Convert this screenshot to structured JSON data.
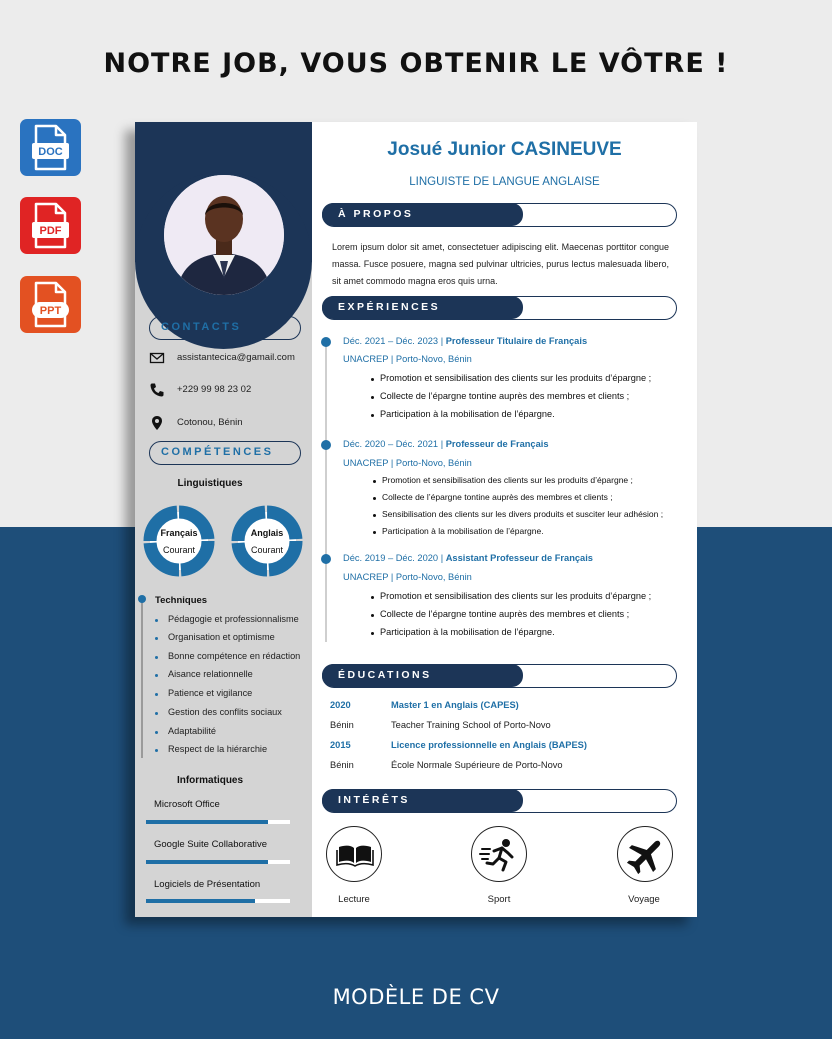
{
  "banner": {
    "headline": "NOTRE JOB, VOUS OBTENIR LE VÔTRE !",
    "footer": "MODÈLE DE CV",
    "file_formats": [
      "DOC",
      "PDF",
      "PPT"
    ],
    "colors": {
      "navy": "#1c3557",
      "accent": "#1f6fa6",
      "doc": "#2a73c0",
      "pdf": "#e02424",
      "ppt": "#e35122",
      "background_dark": "#1e4e79"
    }
  },
  "cv": {
    "name": "Josué Junior CASINEUVE",
    "title": "LINGUISTE DE LANGUE ANGLAISE",
    "contacts": {
      "heading": "CONTACTS",
      "email": "assistantecica@gamail.com",
      "phone": "+229 99 98 23 02",
      "address": "Cotonou, Bénin",
      "icons": [
        "envelope-icon",
        "phone-icon",
        "location-pin-icon"
      ]
    },
    "skills": {
      "heading": "COMPÉTENCES",
      "linguistic_heading": "Linguistiques",
      "languages": [
        {
          "name": "Français",
          "level": "Courant"
        },
        {
          "name": "Anglais",
          "level": "Courant"
        }
      ],
      "technical_heading": "Techniques",
      "technical": [
        "Pédagogie et professionnalisme",
        "Organisation et optimisme",
        "Bonne compétence en rédaction",
        "Aisance relationnelle",
        "Patience et vigilance",
        "Gestion des conflits sociaux",
        "Adaptabilité",
        "Respect de la hiérarchie"
      ],
      "it_heading": "Informatiques",
      "software": [
        {
          "name": "Microsoft Office",
          "level": 0.85
        },
        {
          "name": "Google Suite Collaborative",
          "level": 0.85
        },
        {
          "name": "Logiciels de Présentation",
          "level": 0.76
        }
      ]
    },
    "about": {
      "heading": "À PROPOS",
      "text": "Lorem ipsum dolor sit amet, consectetuer adipiscing elit. Maecenas porttitor congue massa. Fusce posuere, magna sed pulvinar ultricies, purus lectus malesuada libero, sit amet commodo magna eros quis urna."
    },
    "experience": {
      "heading": "EXPÉRIENCES",
      "items": [
        {
          "period": "Déc. 2021 – Déc. 2023",
          "role": "Professeur Titulaire de Français",
          "org": "UNACREP | Porto-Novo, Bénin",
          "bullets": [
            "Promotion et sensibilisation des clients sur les produits d’épargne ;",
            "Collecte de l’épargne tontine auprès des membres et clients ;",
            "Participation à la mobilisation de l’épargne."
          ]
        },
        {
          "period": "Déc. 2020 – Déc. 2021",
          "role": "Professeur de Français",
          "org": "UNACREP | Porto-Novo, Bénin",
          "bullets": [
            "Promotion et sensibilisation des clients sur les produits d’épargne ;",
            "Collecte de l’épargne tontine auprès des membres et clients ;",
            "Sensibilisation des clients sur les divers produits et susciter leur adhésion ;",
            "Participation à la mobilisation de l’épargne."
          ]
        },
        {
          "period": "Déc. 2019 – Déc. 2020",
          "role": "Assistant Professeur de Français",
          "org": "UNACREP | Porto-Novo, Bénin",
          "bullets": [
            "Promotion et sensibilisation des clients sur les produits d’épargne ;",
            "Collecte de l’épargne tontine auprès des membres et clients ;",
            "Participation à la mobilisation de l’épargne."
          ]
        }
      ]
    },
    "education": {
      "heading": "ÉDUCATIONS",
      "items": [
        {
          "year": "2020",
          "degree": "Master 1 en Anglais (CAPES)",
          "city": "Bénin",
          "school": "Teacher Training School of Porto-Novo"
        },
        {
          "year": "2015",
          "degree": "Licence professionnelle en Anglais (BAPES)",
          "city": "Bénin",
          "school": "École Normale Supérieure de Porto-Novo"
        }
      ]
    },
    "interests": {
      "heading": "INTÉRÊTS",
      "items": [
        {
          "label": "Lecture",
          "icon": "book-icon"
        },
        {
          "label": "Sport",
          "icon": "runner-icon"
        },
        {
          "label": "Voyage",
          "icon": "airplane-icon"
        }
      ]
    }
  }
}
